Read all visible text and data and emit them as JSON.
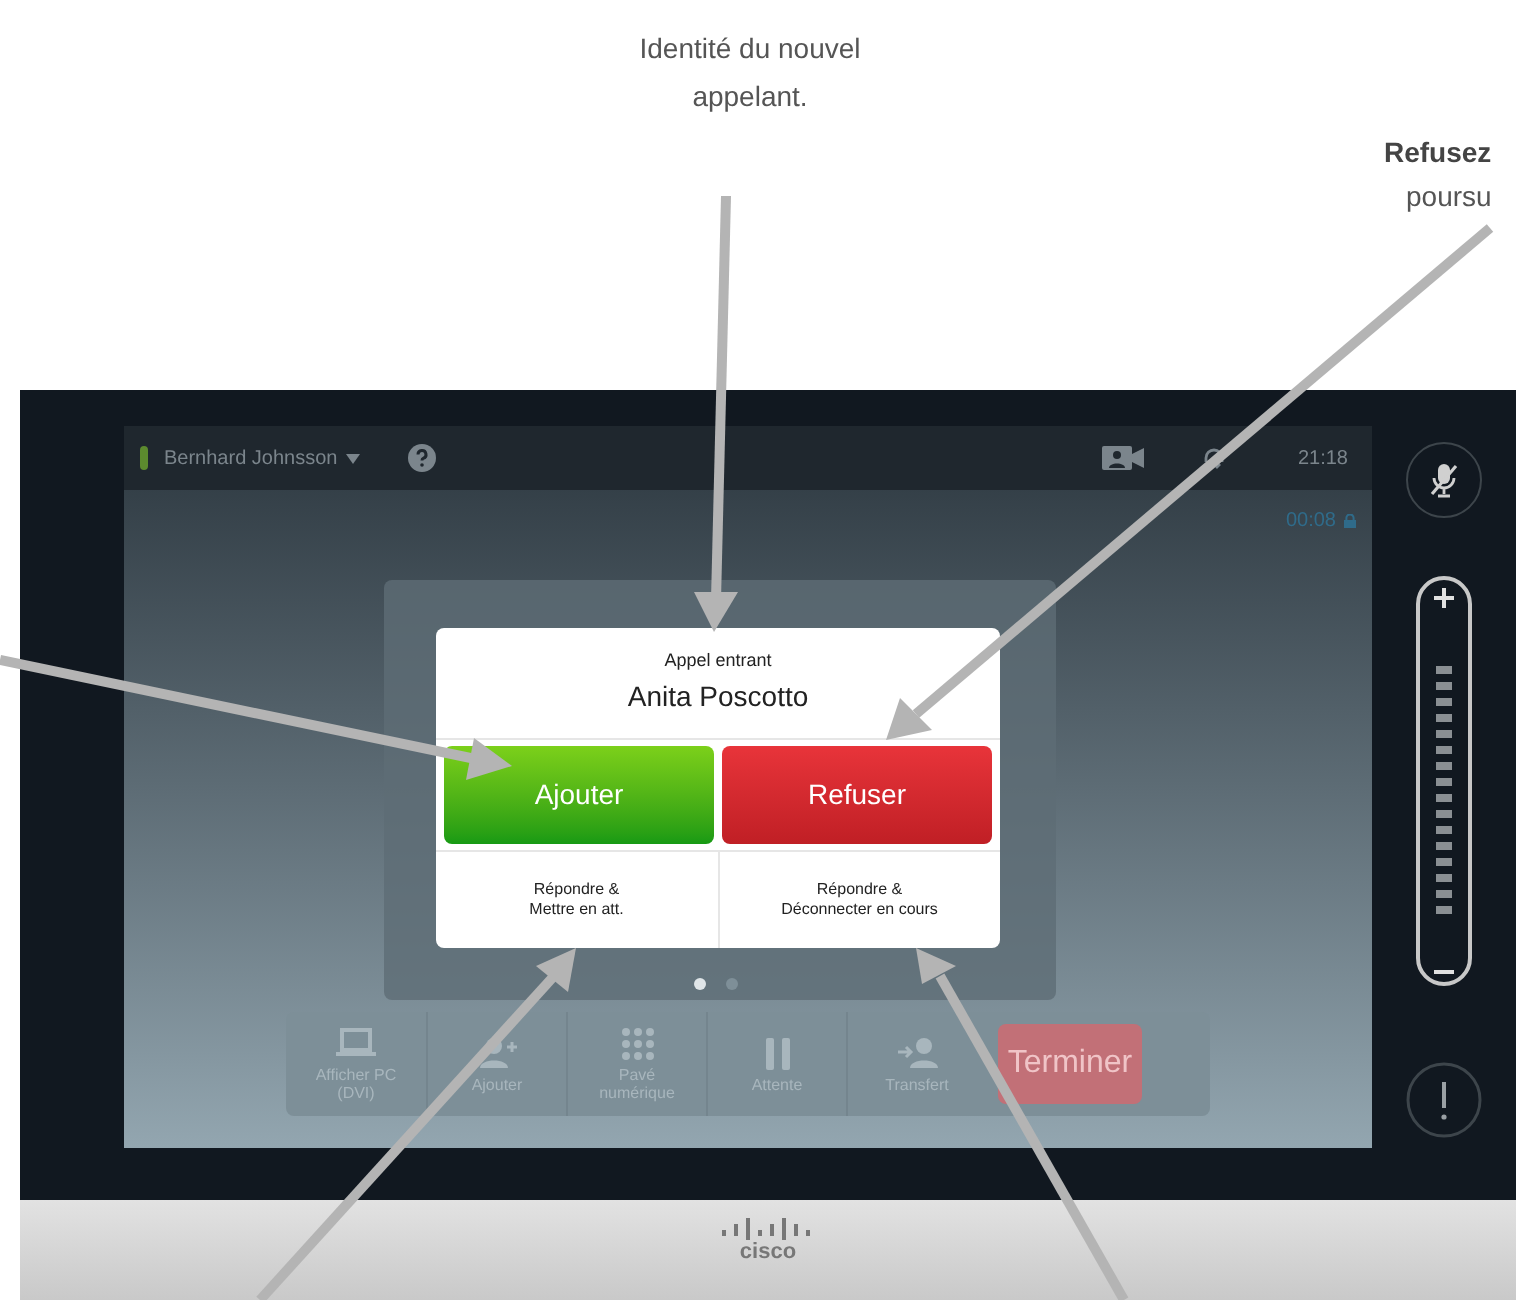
{
  "annotations": [
    {
      "kind": "plain",
      "text": "Identité du nouvel\nappelant."
    },
    {
      "kind": "bold",
      "text": "Refusez"
    },
    {
      "kind": "plain",
      "text": "poursu"
    }
  ],
  "status_bar": {
    "caller": "Bernhard Johnsson",
    "time": "21:18"
  },
  "call_timer": "00:08",
  "dialog": {
    "title": "Appel entrant",
    "caller": "Anita Poscotto",
    "buttons": [
      {
        "label": "Ajouter",
        "kind": "accept"
      },
      {
        "label": "Refuser",
        "kind": "decline"
      }
    ],
    "options": [
      "Répondre &\nMettre en att.",
      "Répondre &\nDéconnecter en cours"
    ]
  },
  "page_dots": [
    {
      "selected": true
    },
    {
      "selected": false
    }
  ],
  "toolbar": [
    {
      "kind": "laptop",
      "label": "Afficher PC\n(DVI)"
    },
    {
      "kind": "add",
      "label": "Ajouter"
    },
    {
      "kind": "keypad",
      "label": "Pavé\nnumérique"
    },
    {
      "kind": "hold",
      "label": "Attente"
    },
    {
      "kind": "transfer",
      "label": "Transfert"
    },
    {
      "kind": "end",
      "label": "Terminer"
    }
  ],
  "brand": "cisco"
}
